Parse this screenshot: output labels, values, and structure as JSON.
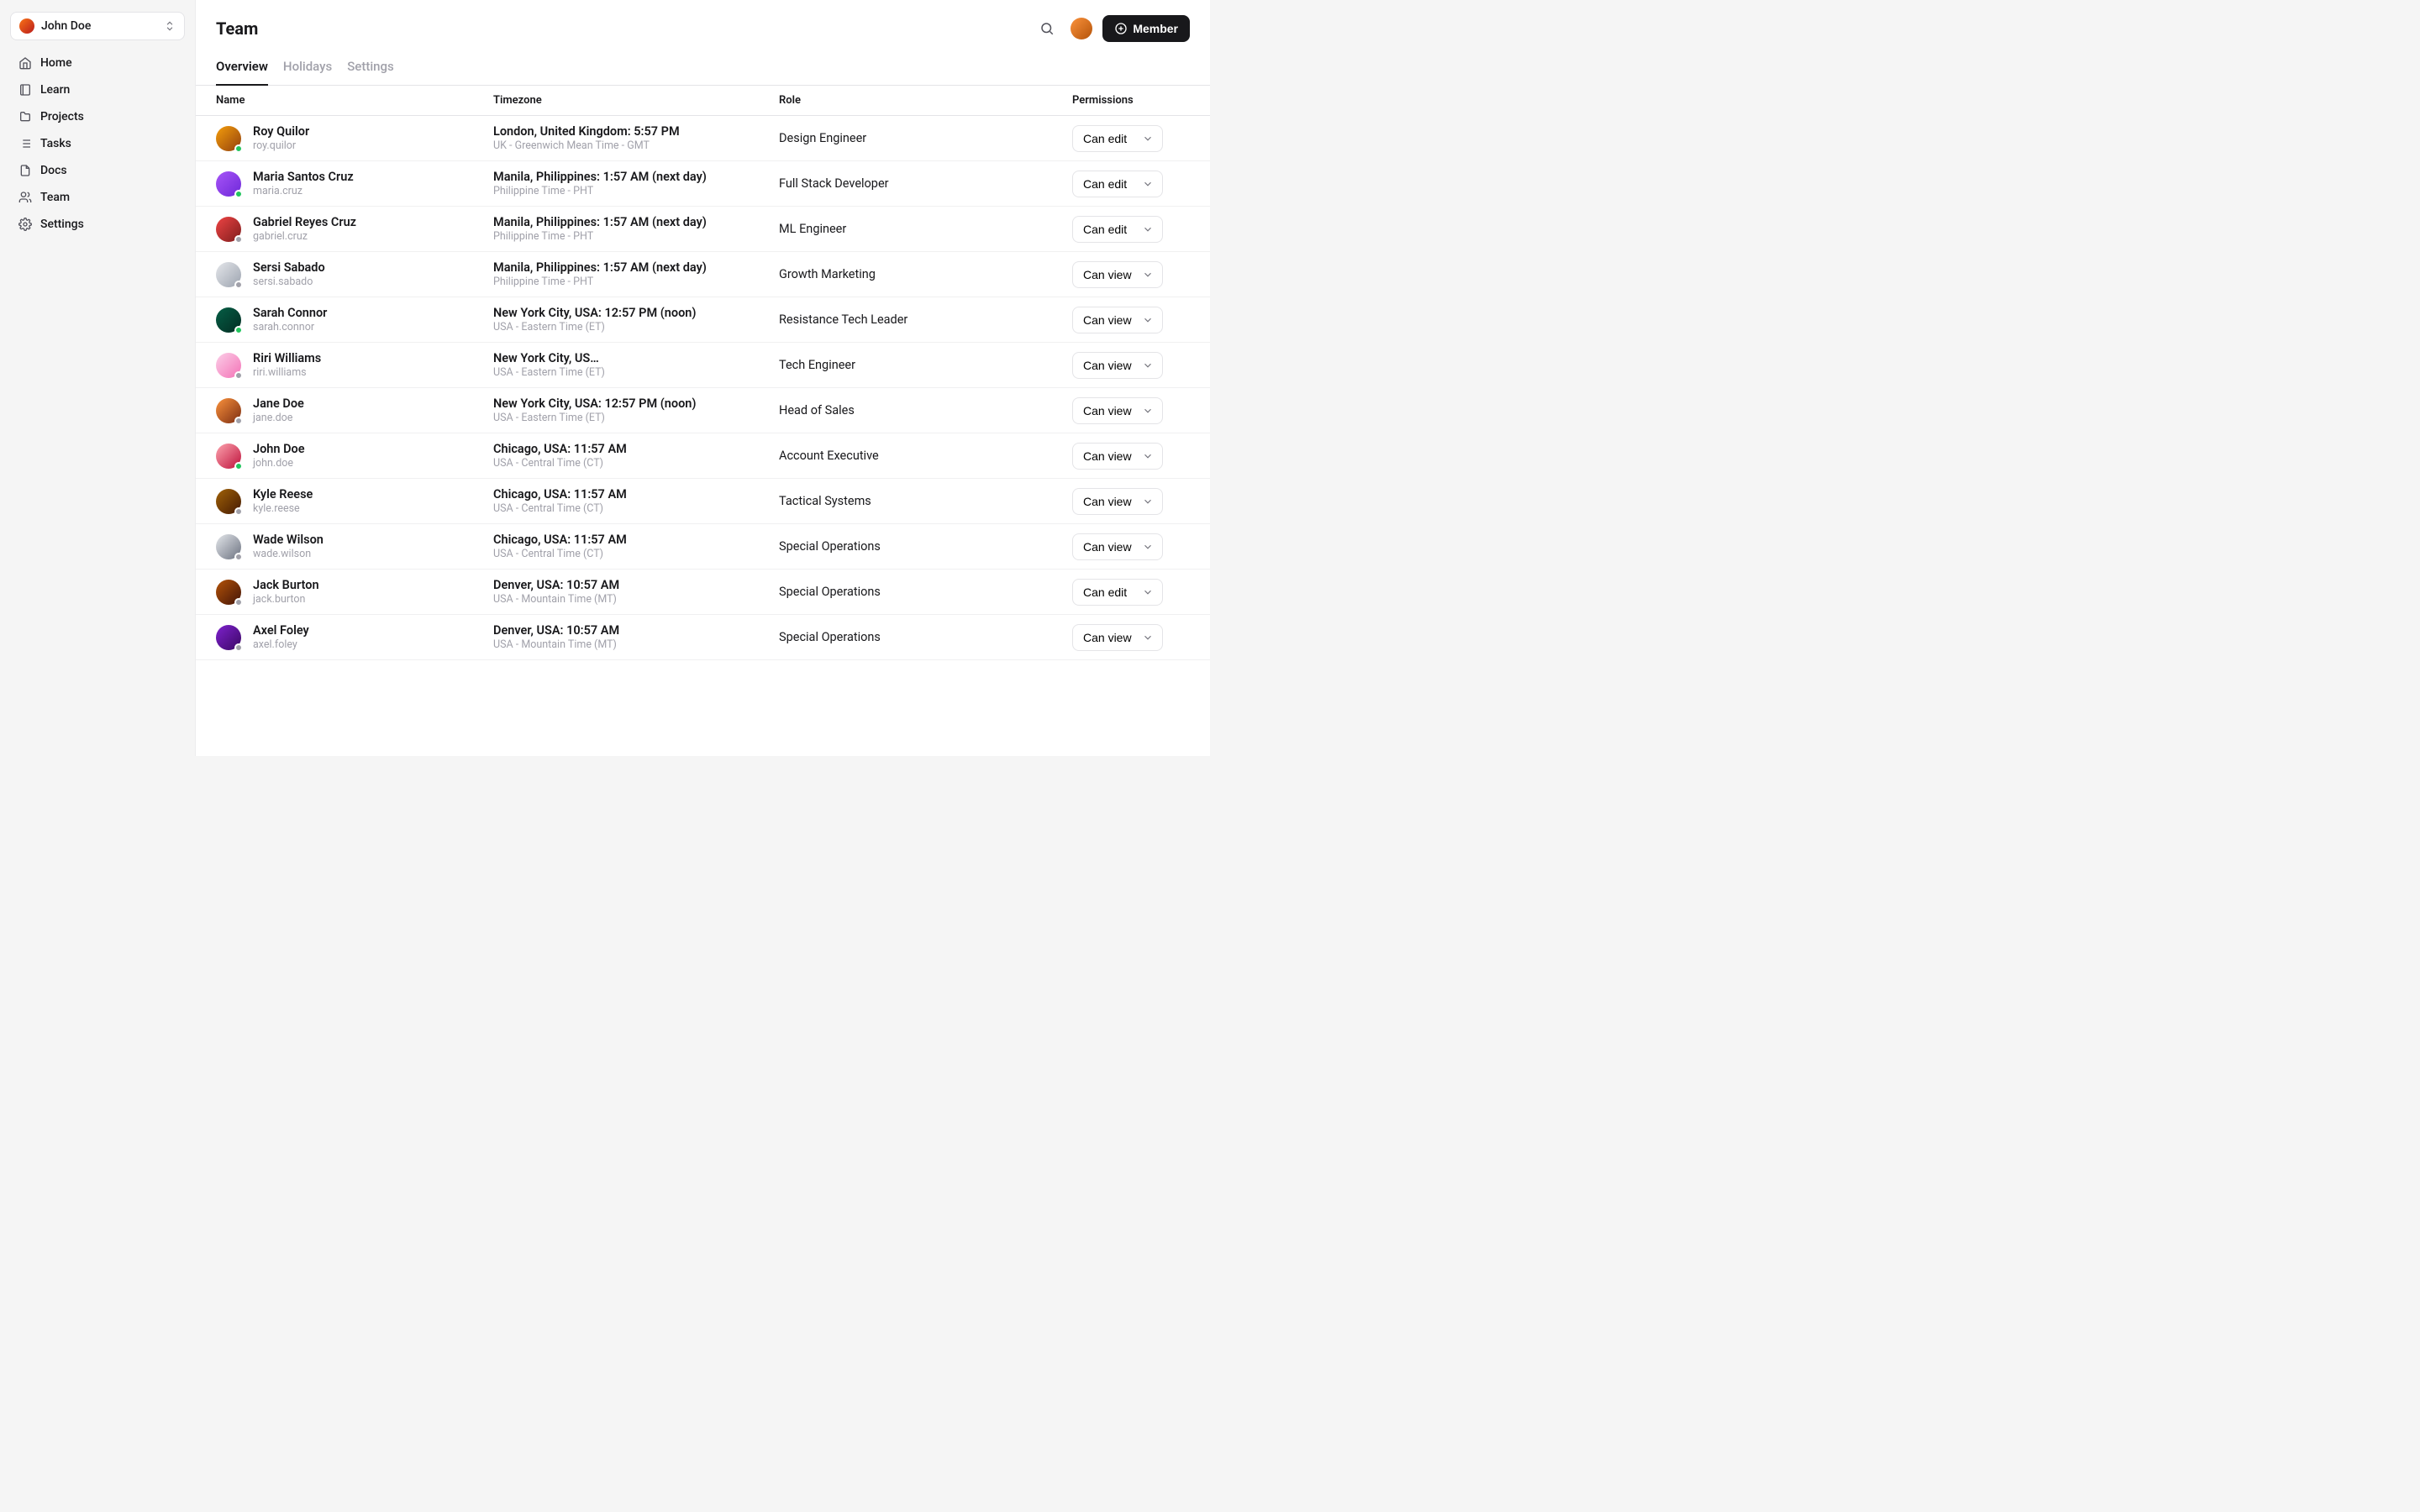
{
  "sidebar": {
    "user_name": "John Doe",
    "items": [
      {
        "icon": "home",
        "label": "Home"
      },
      {
        "icon": "book",
        "label": "Learn"
      },
      {
        "icon": "folder",
        "label": "Projects"
      },
      {
        "icon": "list",
        "label": "Tasks"
      },
      {
        "icon": "file",
        "label": "Docs"
      },
      {
        "icon": "users",
        "label": "Team"
      },
      {
        "icon": "gear",
        "label": "Settings"
      }
    ]
  },
  "header": {
    "title": "Team",
    "add_member_label": "Member"
  },
  "tabs": [
    {
      "label": "Overview",
      "active": true
    },
    {
      "label": "Holidays",
      "active": false
    },
    {
      "label": "Settings",
      "active": false
    }
  ],
  "columns": {
    "name": "Name",
    "timezone": "Timezone",
    "role": "Role",
    "permissions": "Permissions"
  },
  "members": [
    {
      "name": "Roy Quilor",
      "username": "roy.quilor",
      "tz_primary": "London, United Kingdom: 5:57 PM",
      "tz_secondary": "UK - Greenwich Mean Time - GMT",
      "role": "Design Engineer",
      "permission": "Can edit",
      "status": "online",
      "avatar": "av-c0"
    },
    {
      "name": "Maria Santos Cruz",
      "username": "maria.cruz",
      "tz_primary": "Manila, Philippines: 1:57 AM (next day)",
      "tz_secondary": "Philippine Time - PHT",
      "role": "Full Stack Developer",
      "permission": "Can edit",
      "status": "online",
      "avatar": "av-c1"
    },
    {
      "name": "Gabriel Reyes Cruz",
      "username": "gabriel.cruz",
      "tz_primary": "Manila, Philippines: 1:57 AM (next day)",
      "tz_secondary": "Philippine Time - PHT",
      "role": "ML Engineer",
      "permission": "Can edit",
      "status": "offline",
      "avatar": "av-c2"
    },
    {
      "name": "Sersi Sabado",
      "username": "sersi.sabado",
      "tz_primary": "Manila, Philippines: 1:57 AM (next day)",
      "tz_secondary": "Philippine Time - PHT",
      "role": "Growth Marketing",
      "permission": "Can view",
      "status": "offline",
      "avatar": "av-c3"
    },
    {
      "name": "Sarah Connor",
      "username": "sarah.connor",
      "tz_primary": "New York City, USA: 12:57 PM (noon)",
      "tz_secondary": "USA - Eastern Time (ET)",
      "role": "Resistance Tech Leader",
      "permission": "Can view",
      "status": "online",
      "avatar": "av-c4"
    },
    {
      "name": "Riri Williams",
      "username": "riri.williams",
      "tz_primary": "New York City, US…",
      "tz_secondary": "USA - Eastern Time (ET)",
      "role": "Tech Engineer",
      "permission": "Can view",
      "status": "offline",
      "avatar": "av-c5"
    },
    {
      "name": "Jane Doe",
      "username": "jane.doe",
      "tz_primary": "New York City, USA: 12:57 PM (noon)",
      "tz_secondary": "USA - Eastern Time (ET)",
      "role": "Head of Sales",
      "permission": "Can view",
      "status": "offline",
      "avatar": "av-c6"
    },
    {
      "name": "John Doe",
      "username": "john.doe",
      "tz_primary": "Chicago, USA: 11:57 AM",
      "tz_secondary": "USA - Central Time (CT)",
      "role": "Account Executive",
      "permission": "Can view",
      "status": "online",
      "avatar": "av-c7"
    },
    {
      "name": "Kyle Reese",
      "username": "kyle.reese",
      "tz_primary": "Chicago, USA: 11:57 AM",
      "tz_secondary": "USA - Central Time (CT)",
      "role": "Tactical Systems",
      "permission": "Can view",
      "status": "offline",
      "avatar": "av-c8"
    },
    {
      "name": "Wade Wilson",
      "username": "wade.wilson",
      "tz_primary": "Chicago, USA: 11:57 AM",
      "tz_secondary": "USA - Central Time (CT)",
      "role": "Special Operations",
      "permission": "Can view",
      "status": "offline",
      "avatar": "av-c9"
    },
    {
      "name": "Jack Burton",
      "username": "jack.burton",
      "tz_primary": "Denver, USA: 10:57 AM",
      "tz_secondary": "USA - Mountain Time (MT)",
      "role": "Special Operations",
      "permission": "Can edit",
      "status": "offline",
      "avatar": "av-c10"
    },
    {
      "name": "Axel Foley",
      "username": "axel.foley",
      "tz_primary": "Denver, USA: 10:57 AM",
      "tz_secondary": "USA - Mountain Time (MT)",
      "role": "Special Operations",
      "permission": "Can view",
      "status": "offline",
      "avatar": "av-c11"
    }
  ]
}
